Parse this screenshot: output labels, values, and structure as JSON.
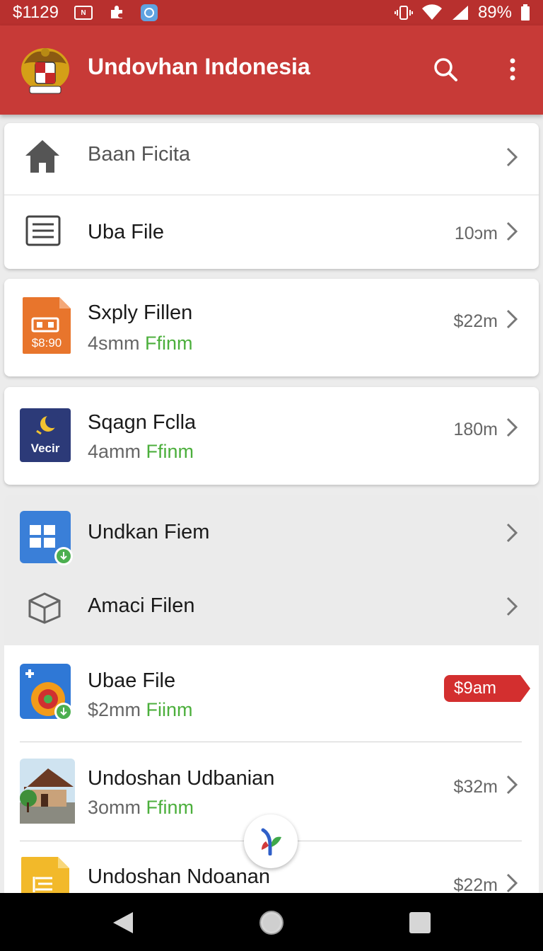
{
  "status_bar": {
    "time": "$1129",
    "battery": "89%",
    "icons": [
      "news-icon",
      "puzzle-icon",
      "app-icon",
      "vibrate-icon",
      "wifi-icon",
      "signal-icon",
      "battery-icon"
    ]
  },
  "app_bar": {
    "title": "Undovhan Indonesia",
    "icons": [
      "emblem-logo",
      "search-icon",
      "overflow-menu-icon"
    ]
  },
  "cards": [
    {
      "items": [
        {
          "title": "Baan Ficita",
          "icon": "home-icon"
        },
        {
          "title": "Uba File",
          "meta": "10ɔm",
          "icon": "list-icon"
        }
      ]
    },
    {
      "items": [
        {
          "title": "Sxply Fillen",
          "sub_prefix": "4smm",
          "sub_status": "Ffinm",
          "meta": "$22m",
          "icon": "orange-doc-icon",
          "icon_text": "$8:90"
        }
      ]
    },
    {
      "items": [
        {
          "title": "Sqagn Fclla",
          "sub_prefix": "4amm",
          "sub_status": "Ffinm",
          "meta": "180m",
          "icon": "vecir-app-icon",
          "icon_text": "Vecir"
        }
      ]
    }
  ],
  "list": [
    {
      "title": "Undkan Fiem",
      "icon": "blue-grid-icon"
    },
    {
      "title": "Amaci Filen",
      "icon": "box-icon"
    },
    {
      "title": "Ubae File",
      "sub_prefix": "$2mm",
      "sub_status": "Fiinm",
      "badge": "$9am",
      "icon": "media-app-icon"
    },
    {
      "title": "Undoshan Udbanian",
      "sub_prefix": "3omm",
      "sub_status": "Ffinm",
      "meta": "$32m",
      "icon": "house-photo-icon"
    },
    {
      "title": "Undoshan Ndoanan",
      "meta": "$22m",
      "icon": "yellow-doc-icon"
    }
  ],
  "colors": {
    "primary": "#c73a37",
    "status_bar": "#b8302e",
    "accent_green": "#4caf3c",
    "badge_red": "#d32f2f"
  }
}
